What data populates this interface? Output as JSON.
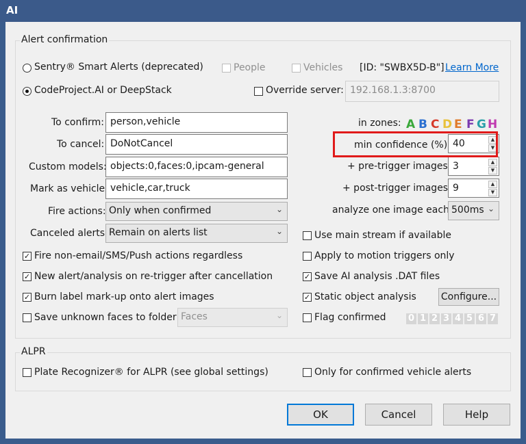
{
  "window": {
    "title": "AI"
  },
  "alert_confirmation": {
    "group_label": "Alert confirmation",
    "sentry_label": "Sentry® Smart Alerts (deprecated)",
    "people_label": "People",
    "vehicles_label": "Vehicles",
    "id_text": "[ID: \"SWBX5D-B\"]",
    "learn_more": "Learn More",
    "codeproject_label": "CodeProject.AI or DeepStack",
    "override_label": "Override server:",
    "server_value": "192.168.1.3:8700",
    "to_confirm_label": "To confirm:",
    "to_confirm_value": "person,vehicle",
    "to_cancel_label": "To cancel:",
    "to_cancel_value": "DoNotCancel",
    "custom_models_label": "Custom models:",
    "custom_models_value": "objects:0,faces:0,ipcam-general",
    "mark_vehicle_label": "Mark as vehicle:",
    "mark_vehicle_value": "vehicle,car,truck",
    "fire_actions_label": "Fire actions:",
    "fire_actions_value": "Only when confirmed",
    "canceled_alerts_label": "Canceled alerts:",
    "canceled_alerts_value": "Remain on alerts list",
    "in_zones_label": "in zones:",
    "zones": [
      "A",
      "B",
      "C",
      "D",
      "E",
      "F",
      "G",
      "H"
    ],
    "zone_colors": [
      "#3aa83a",
      "#2a6fd0",
      "#d63a2a",
      "#e8c13a",
      "#e07a2a",
      "#7a3ab0",
      "#2aa0a8",
      "#c03ab0"
    ],
    "min_conf_label": "min confidence (%):",
    "min_conf_value": "40",
    "pre_trigger_label": "+ pre-trigger images:",
    "pre_trigger_value": "3",
    "post_trigger_label": "+ post-trigger images:",
    "post_trigger_value": "9",
    "analyze_label": "analyze one image each:",
    "analyze_value": "500ms",
    "use_main_label": "Use main stream if available",
    "fire_nonemail_label": "Fire non-email/SMS/Push actions regardless",
    "apply_motion_label": "Apply to motion triggers only",
    "new_alert_label": "New alert/analysis on re-trigger after cancellation",
    "save_dat_label": "Save AI analysis .DAT files",
    "burn_label": "Burn label mark-up onto alert images",
    "static_label": "Static object analysis",
    "configure_label": "Configure...",
    "save_faces_label": "Save unknown faces to folder",
    "faces_value": "Faces",
    "flag_label": "Flag confirmed",
    "flag_digits": [
      "0",
      "1",
      "2",
      "3",
      "4",
      "5",
      "6",
      "7"
    ]
  },
  "alpr": {
    "group_label": "ALPR",
    "plate_label": "Plate Recognizer® for ALPR (see global settings)",
    "only_vehicle_label": "Only for confirmed vehicle alerts"
  },
  "buttons": {
    "ok": "OK",
    "cancel": "Cancel",
    "help": "Help"
  }
}
